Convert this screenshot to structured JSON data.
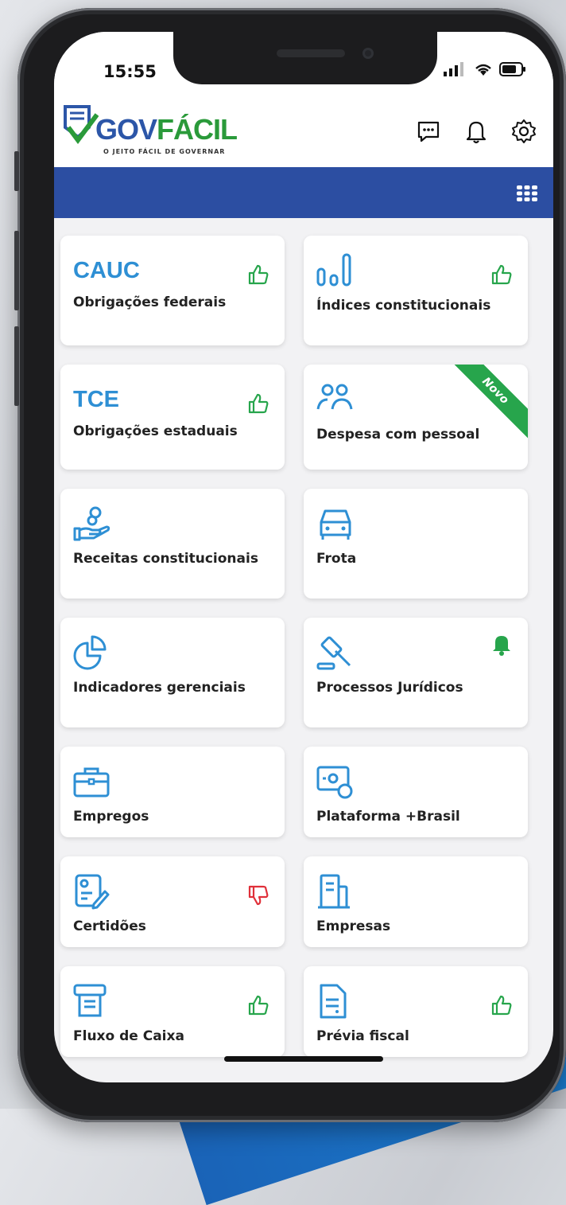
{
  "status": {
    "time": "15:55"
  },
  "header": {
    "logo_text_main": "GOV",
    "logo_text_accent": "FÁCIL",
    "logo_tagline": "O JEITO FÁCIL DE GOVERNAR"
  },
  "cards": [
    {
      "big": "CAUC",
      "title": "Obrigações federais",
      "badge": "thumbs-up",
      "icon": ""
    },
    {
      "big": "",
      "title": "Índices constitucionais",
      "badge": "thumbs-up",
      "icon": "bar-chart-icon"
    },
    {
      "big": "TCE",
      "title": "Obrigações estaduais",
      "badge": "thumbs-up",
      "icon": ""
    },
    {
      "big": "",
      "title": "Despesa com pessoal",
      "badge": "",
      "icon": "people-icon",
      "ribbon": "Novo"
    },
    {
      "big": "",
      "title": "Receitas constitucionais",
      "badge": "",
      "icon": "coin-hand-icon"
    },
    {
      "big": "",
      "title": "Frota",
      "badge": "",
      "icon": "car-icon"
    },
    {
      "big": "",
      "title": "Indicadores gerenciais",
      "badge": "",
      "icon": "pie-chart-icon"
    },
    {
      "big": "",
      "title": "Processos Jurídicos",
      "badge": "bell",
      "icon": "gavel-icon"
    },
    {
      "big": "",
      "title": "Empregos",
      "badge": "",
      "icon": "briefcase-icon"
    },
    {
      "big": "",
      "title": "Plataforma +Brasil",
      "badge": "",
      "icon": "money-icon"
    },
    {
      "big": "",
      "title": "Certidões",
      "badge": "thumbs-down",
      "icon": "certificate-icon"
    },
    {
      "big": "",
      "title": "Empresas",
      "badge": "",
      "icon": "building-icon"
    },
    {
      "big": "",
      "title": "Fluxo de Caixa",
      "badge": "thumbs-up",
      "icon": "cash-register-icon"
    },
    {
      "big": "",
      "title": "Prévia fiscal",
      "badge": "thumbs-up",
      "icon": "document-icon"
    }
  ],
  "colors": {
    "brand_blue": "#2c4ea2",
    "accent_blue": "#2e8fd4",
    "positive_green": "#27a54c",
    "negative_red": "#e0303a"
  }
}
